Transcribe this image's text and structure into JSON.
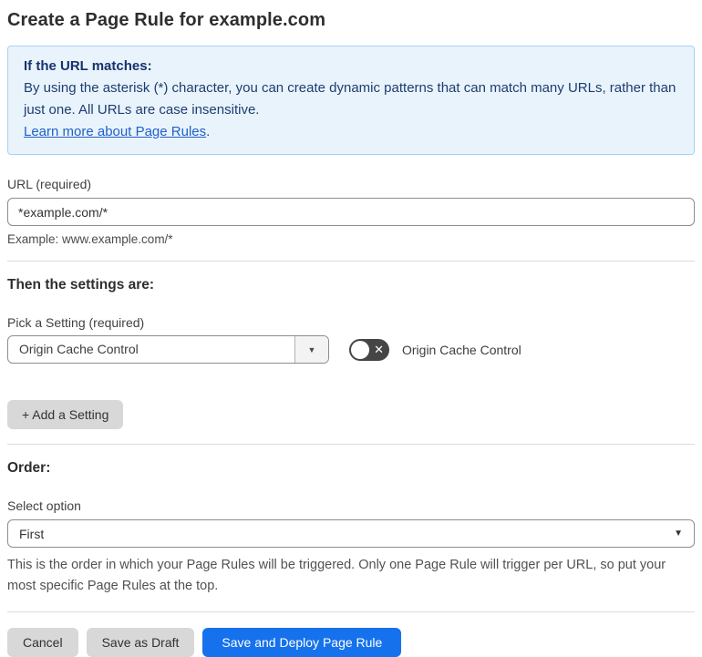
{
  "page": {
    "title": "Create a Page Rule for example.com"
  },
  "info_box": {
    "heading": "If the URL matches:",
    "body": "By using the asterisk (*) character, you can create dynamic patterns that can match many URLs, rather than just one. All URLs are case insensitive.",
    "link_label": "Learn more about Page Rules",
    "link_suffix": "."
  },
  "url_field": {
    "label": "URL (required)",
    "value": "*example.com/*",
    "example": "Example: www.example.com/*"
  },
  "settings_section": {
    "heading": "Then the settings are:",
    "pick_label": "Pick a Setting (required)",
    "selected_setting": "Origin Cache Control",
    "toggle_state": "off",
    "toggle_label": "Origin Cache Control",
    "add_button_label": "+ Add a Setting"
  },
  "order_section": {
    "heading": "Order:",
    "select_label": "Select option",
    "selected_option": "First",
    "help": "This is the order in which your Page Rules will be triggered. Only one Page Rule will trigger per URL, so put your most specific Page Rules at the top."
  },
  "footer": {
    "cancel_label": "Cancel",
    "save_draft_label": "Save as Draft",
    "save_deploy_label": "Save and Deploy Page Rule"
  },
  "icons": {
    "dropdown_arrow": "▼",
    "toggle_x": "✕"
  },
  "colors": {
    "info_box_bg": "#e9f3fc",
    "info_box_border": "#a9d2f0",
    "info_text": "#1e3d70",
    "link_blue": "#2061c9",
    "primary_button_blue": "#1672ec",
    "gray_button_bg": "#d8d8d8",
    "toggle_off_bg": "#454545"
  }
}
